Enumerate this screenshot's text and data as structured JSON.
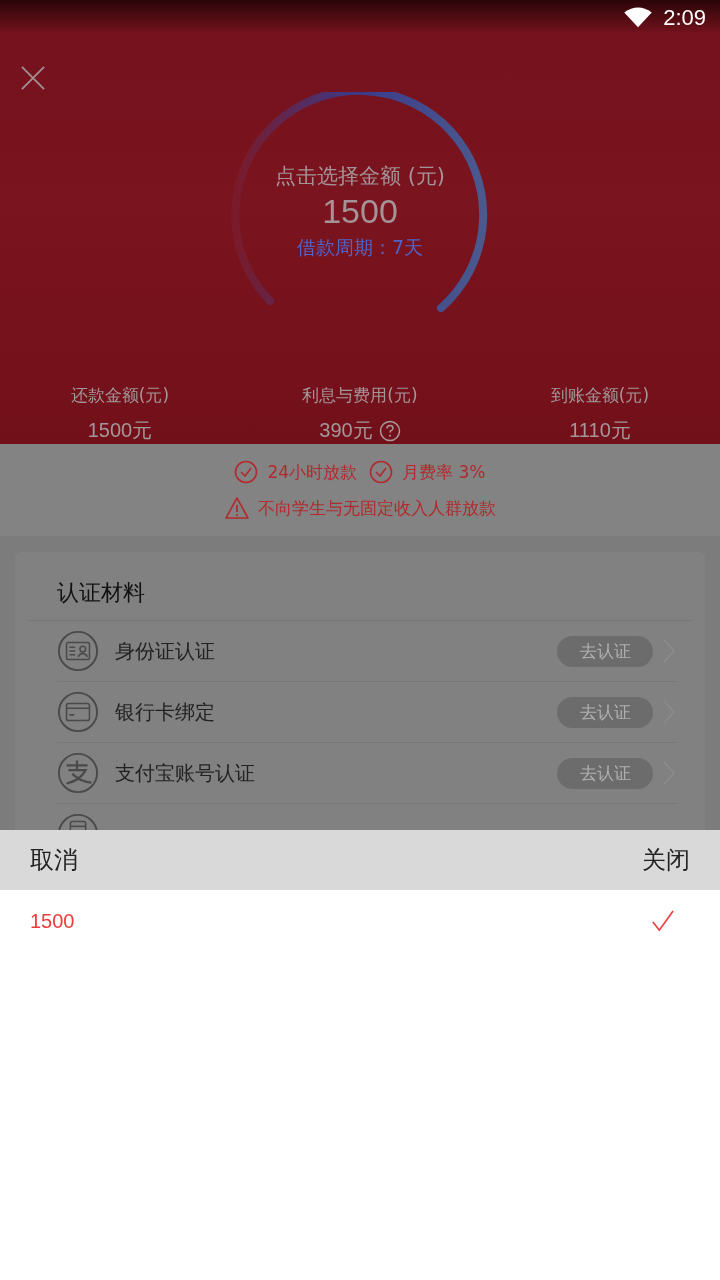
{
  "status_bar": {
    "time": "2:09"
  },
  "hero": {
    "title": "点击选择金额 (元)",
    "amount": "1500",
    "period": "借款周期：7天",
    "stats": [
      {
        "label": "还款金额(元)",
        "value": "1500元",
        "info": false
      },
      {
        "label": "利息与费用(元)",
        "value": "390元",
        "info": true
      },
      {
        "label": "到账金额(元)",
        "value": "1110元",
        "info": false
      }
    ]
  },
  "features": [
    {
      "kind": "check",
      "text": "24小时放款"
    },
    {
      "kind": "check",
      "text": "月费率 3%"
    },
    {
      "kind": "warning",
      "text": "不向学生与无固定收入人群放款"
    }
  ],
  "card": {
    "title": "认证材料",
    "items": [
      {
        "kind": "id",
        "label": "身份证认证",
        "button": "去认证"
      },
      {
        "kind": "card",
        "label": "银行卡绑定",
        "button": "去认证"
      },
      {
        "kind": "alipay",
        "label": "支付宝账号认证",
        "button": "去认证"
      },
      {
        "kind": "phone"
      }
    ]
  },
  "picker": {
    "cancel": "取消",
    "close": "关闭",
    "options": [
      {
        "value": "1500",
        "selected": true
      }
    ]
  }
}
